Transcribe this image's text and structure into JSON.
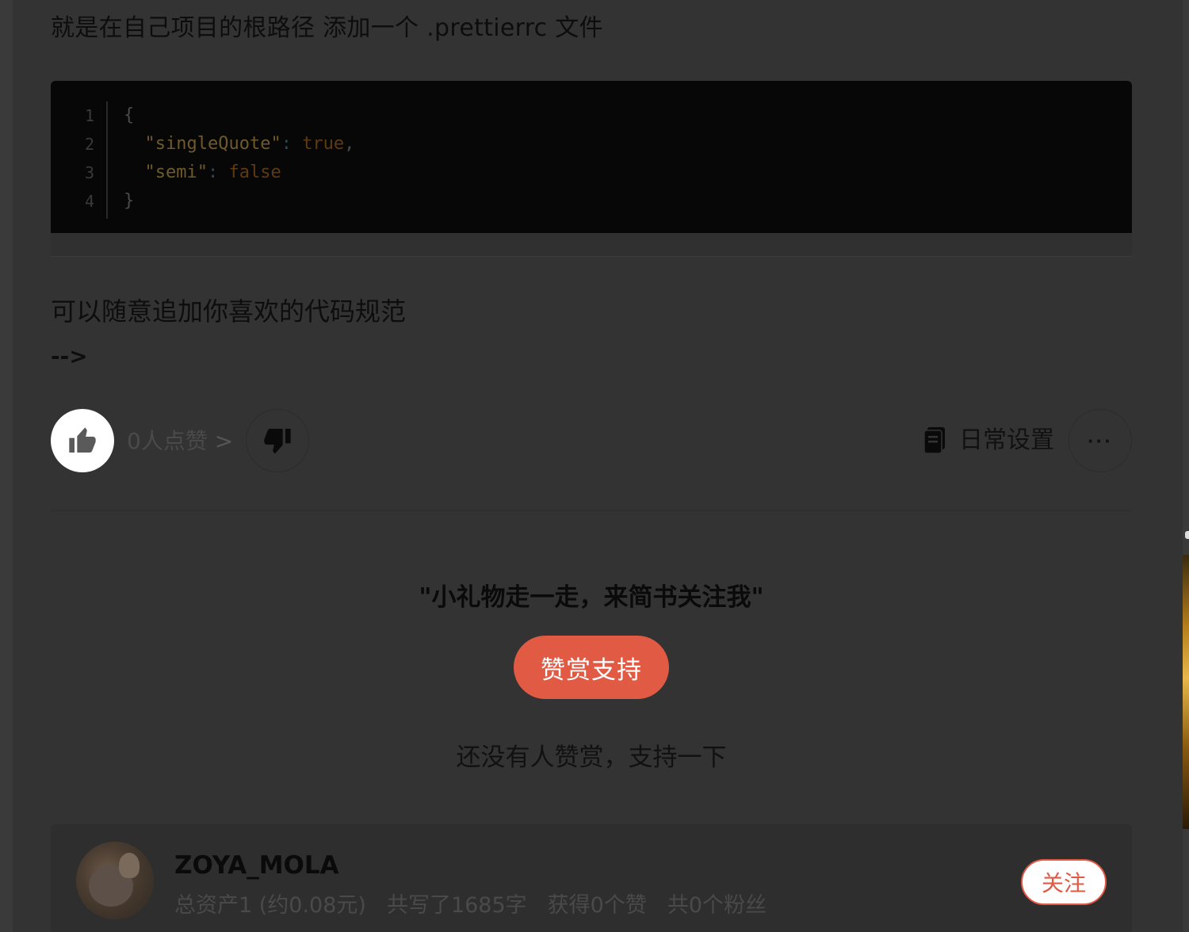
{
  "article": {
    "para_prettierrc": "就是在自己项目的根路径 添加一个 .prettierrc 文件",
    "code": {
      "line_numbers": [
        "1",
        "2",
        "3",
        "4"
      ],
      "line1": "{",
      "line2_key": "\"singleQuote\"",
      "line2_colon": ":",
      "line2_val": "true",
      "line2_comma": ",",
      "line3_key": "\"semi\"",
      "line3_colon": ":",
      "line3_val": "false",
      "line4": "}"
    },
    "para_custom": "可以随意追加你喜欢的代码规范",
    "arrow": "-->"
  },
  "actions": {
    "like_count": "0人点赞",
    "like_chevron": ">",
    "notebook_label": "日常设置",
    "more_label": "···"
  },
  "reward": {
    "title": "\"小礼物走一走，来简书关注我\"",
    "button": "赞赏支持",
    "hint": "还没有人赞赏，支持一下"
  },
  "author": {
    "name": "ZOYA_MOLA",
    "assets": "总资产1 (约0.08元)",
    "words": "共写了1685字",
    "likes": "获得0个赞",
    "fans": "共0个粉丝",
    "follow": "关注"
  },
  "colors": {
    "accent": "#e05a44",
    "page_bg": "#333333",
    "code_bg": "#070707"
  }
}
